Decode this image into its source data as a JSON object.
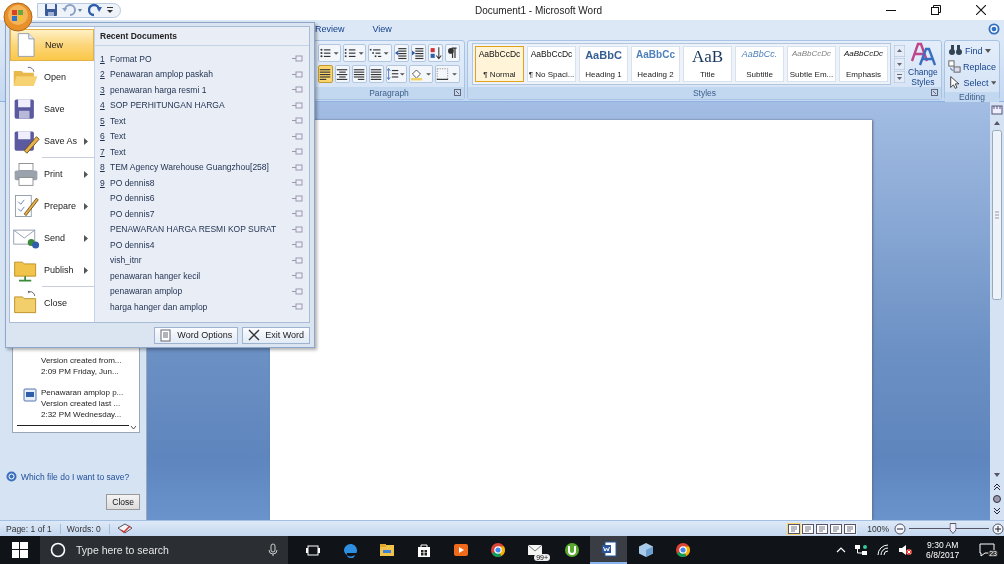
{
  "window": {
    "title": "Document1 - Microsoft Word"
  },
  "ribbon_tabs": [
    {
      "label": "Review",
      "selected": false
    },
    {
      "label": "View",
      "selected": false
    }
  ],
  "paragraph_group": {
    "label": "Paragraph",
    "align_left_selected": true
  },
  "styles_group": {
    "label": "Styles",
    "styles": [
      {
        "preview": "AaBbCcDc",
        "name": "¶ Normal",
        "kind": "normal",
        "selected": true
      },
      {
        "preview": "AaBbCcDc",
        "name": "¶ No Spaci...",
        "kind": "normal",
        "selected": false
      },
      {
        "preview": "AaBbC",
        "name": "Heading 1",
        "kind": "heading1",
        "selected": false
      },
      {
        "preview": "AaBbCc",
        "name": "Heading 2",
        "kind": "heading2",
        "selected": false
      },
      {
        "preview": "AaB",
        "name": "Title",
        "kind": "title",
        "selected": false
      },
      {
        "preview": "AaBbCc.",
        "name": "Subtitle",
        "kind": "subtitle",
        "selected": false
      },
      {
        "preview": "AaBbCcDc",
        "name": "Subtle Em...",
        "kind": "subtle",
        "selected": false
      },
      {
        "preview": "AaBbCcDc",
        "name": "Emphasis",
        "kind": "emphasis",
        "selected": false
      }
    ],
    "change_styles": "Change Styles"
  },
  "editing_group": {
    "label": "Editing",
    "commands": [
      {
        "label": "Find",
        "kind": "find"
      },
      {
        "label": "Replace",
        "kind": "replace"
      },
      {
        "label": "Select",
        "kind": "select"
      }
    ]
  },
  "office_menu": {
    "command_groups": [
      [
        {
          "label": "New",
          "kind": "new",
          "submenu": false,
          "selected": true
        },
        {
          "label": "Open",
          "kind": "open",
          "submenu": false,
          "selected": false
        },
        {
          "label": "Save",
          "kind": "save",
          "submenu": false,
          "selected": false
        },
        {
          "label": "Save As",
          "kind": "saveas",
          "submenu": true,
          "selected": false
        }
      ],
      [
        {
          "label": "Print",
          "kind": "print",
          "submenu": true,
          "selected": false
        },
        {
          "label": "Prepare",
          "kind": "prepare",
          "submenu": true,
          "selected": false
        },
        {
          "label": "Send",
          "kind": "send",
          "submenu": true,
          "selected": false
        },
        {
          "label": "Publish",
          "kind": "publish",
          "submenu": true,
          "selected": false
        }
      ],
      [
        {
          "label": "Close",
          "kind": "close",
          "submenu": false,
          "selected": false
        }
      ]
    ],
    "recent_title": "Recent Documents",
    "recent_documents": [
      {
        "number": "1",
        "name": "Format PO"
      },
      {
        "number": "2",
        "name": "Penawaran amplop paskah"
      },
      {
        "number": "3",
        "name": "penawaran harga resmi 1"
      },
      {
        "number": "4",
        "name": "SOP PERHITUNGAN HARGA"
      },
      {
        "number": "5",
        "name": "Text"
      },
      {
        "number": "6",
        "name": "Text"
      },
      {
        "number": "7",
        "name": "Text"
      },
      {
        "number": "8",
        "name": "TEM Agency Warehouse Guangzhou[258]"
      },
      {
        "number": "9",
        "name": "PO dennis8"
      },
      {
        "name": "PO dennis6"
      },
      {
        "name": "PO dennis7"
      },
      {
        "name": "PENAWARAN HARGA RESMI KOP SURAT"
      },
      {
        "name": "PO dennis4"
      },
      {
        "name": "vish_itnr"
      },
      {
        "name": "penawaran hanger kecil"
      },
      {
        "name": "penawaran amplop"
      },
      {
        "name": "harga hanger dan amplop"
      }
    ],
    "buttons": [
      {
        "label": "Word Options",
        "kind": "options"
      },
      {
        "label": "Exit Word",
        "kind": "exit"
      }
    ]
  },
  "recovery_pane": {
    "versions": [
      {
        "lines": [
          "Version created from...",
          "2:09 PM Friday, Jun..."
        ]
      },
      {
        "title": "Penawaran amplop p...",
        "lines": [
          "Version created last ...",
          "2:32 PM Wednesday..."
        ]
      }
    ],
    "help_link": "Which file do I want to save?",
    "close_button": "Close"
  },
  "status_bar": {
    "page": "Page: 1 of 1",
    "words": "Words: 0",
    "views": [
      {
        "selected": true
      },
      {
        "selected": false
      },
      {
        "selected": false
      },
      {
        "selected": false
      },
      {
        "selected": false
      }
    ],
    "zoom": "100%",
    "zoom_slider": {
      "level": 0.55
    }
  },
  "taskbar": {
    "search_placeholder": "Type here to search",
    "apps": [
      {
        "kind": "taskview",
        "active": false
      },
      {
        "kind": "edge",
        "active": false
      },
      {
        "kind": "explorer",
        "active": false
      },
      {
        "kind": "store",
        "active": false
      },
      {
        "kind": "media",
        "active": false
      },
      {
        "kind": "chrome",
        "active": false
      },
      {
        "kind": "mail",
        "active": false,
        "badge": "99+"
      },
      {
        "kind": "torrent",
        "active": false
      },
      {
        "kind": "word",
        "active": true
      },
      {
        "kind": "box",
        "active": false
      },
      {
        "kind": "chrome",
        "active": false
      }
    ],
    "time": "9:30 AM",
    "date": "6/8/2017",
    "notifications": "23"
  }
}
